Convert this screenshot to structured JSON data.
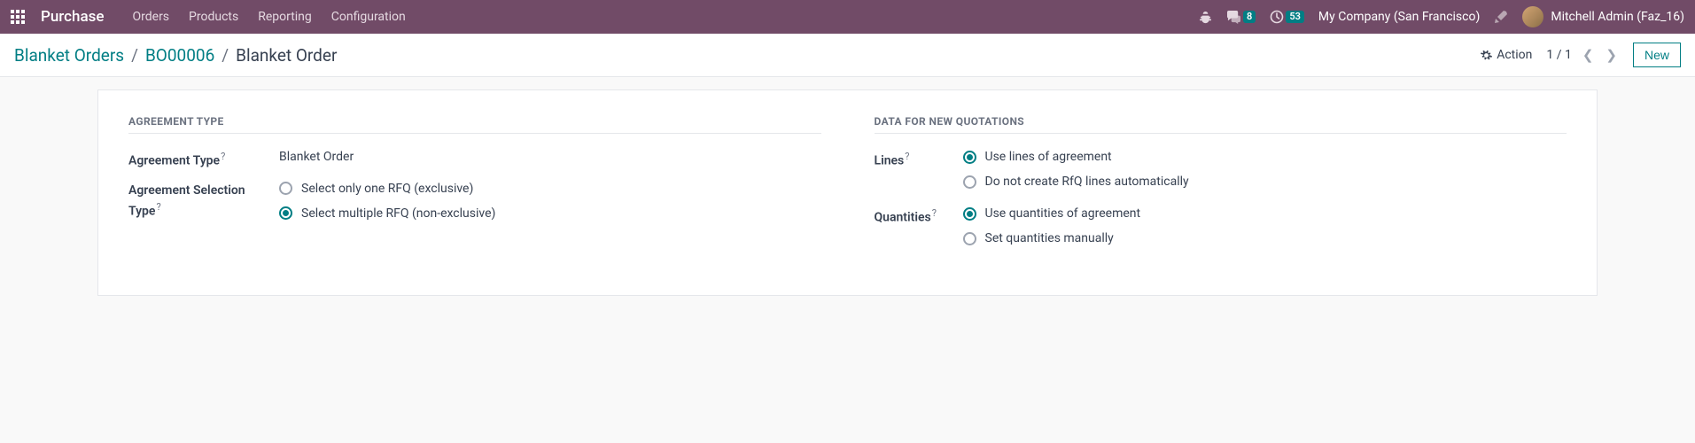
{
  "navbar": {
    "app": "Purchase",
    "menu": [
      "Orders",
      "Products",
      "Reporting",
      "Configuration"
    ],
    "messages_badge": "8",
    "activities_badge": "53",
    "company": "My Company (San Francisco)",
    "user": "Mitchell Admin (Faz_16)"
  },
  "toolbar": {
    "crumb1": "Blanket Orders",
    "crumb2": "BO00006",
    "crumb3": "Blanket Order",
    "action_label": "Action",
    "pager": "1 / 1",
    "new_label": "New"
  },
  "form": {
    "section_agreement": "AGREEMENT TYPE",
    "section_data": "DATA FOR NEW QUOTATIONS",
    "agreement_type_label": "Agreement Type",
    "agreement_type_value": "Blanket Order",
    "selection_label": "Agreement Selection Type",
    "selection_opts": {
      "a": "Select only one RFQ (exclusive)",
      "b": "Select multiple RFQ (non-exclusive)"
    },
    "lines_label": "Lines",
    "lines_opts": {
      "a": "Use lines of agreement",
      "b": "Do not create RfQ lines automatically"
    },
    "qty_label": "Quantities",
    "qty_opts": {
      "a": "Use quantities of agreement",
      "b": "Set quantities manually"
    }
  }
}
